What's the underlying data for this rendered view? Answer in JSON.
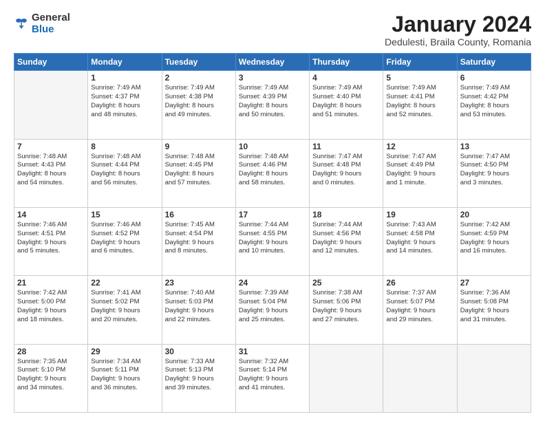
{
  "logo": {
    "general": "General",
    "blue": "Blue"
  },
  "title": "January 2024",
  "subtitle": "Dedulesti, Braila County, Romania",
  "days_header": [
    "Sunday",
    "Monday",
    "Tuesday",
    "Wednesday",
    "Thursday",
    "Friday",
    "Saturday"
  ],
  "weeks": [
    [
      {
        "day": "",
        "info": ""
      },
      {
        "day": "1",
        "info": "Sunrise: 7:49 AM\nSunset: 4:37 PM\nDaylight: 8 hours\nand 48 minutes."
      },
      {
        "day": "2",
        "info": "Sunrise: 7:49 AM\nSunset: 4:38 PM\nDaylight: 8 hours\nand 49 minutes."
      },
      {
        "day": "3",
        "info": "Sunrise: 7:49 AM\nSunset: 4:39 PM\nDaylight: 8 hours\nand 50 minutes."
      },
      {
        "day": "4",
        "info": "Sunrise: 7:49 AM\nSunset: 4:40 PM\nDaylight: 8 hours\nand 51 minutes."
      },
      {
        "day": "5",
        "info": "Sunrise: 7:49 AM\nSunset: 4:41 PM\nDaylight: 8 hours\nand 52 minutes."
      },
      {
        "day": "6",
        "info": "Sunrise: 7:49 AM\nSunset: 4:42 PM\nDaylight: 8 hours\nand 53 minutes."
      }
    ],
    [
      {
        "day": "7",
        "info": "Sunrise: 7:48 AM\nSunset: 4:43 PM\nDaylight: 8 hours\nand 54 minutes."
      },
      {
        "day": "8",
        "info": "Sunrise: 7:48 AM\nSunset: 4:44 PM\nDaylight: 8 hours\nand 56 minutes."
      },
      {
        "day": "9",
        "info": "Sunrise: 7:48 AM\nSunset: 4:45 PM\nDaylight: 8 hours\nand 57 minutes."
      },
      {
        "day": "10",
        "info": "Sunrise: 7:48 AM\nSunset: 4:46 PM\nDaylight: 8 hours\nand 58 minutes."
      },
      {
        "day": "11",
        "info": "Sunrise: 7:47 AM\nSunset: 4:48 PM\nDaylight: 9 hours\nand 0 minutes."
      },
      {
        "day": "12",
        "info": "Sunrise: 7:47 AM\nSunset: 4:49 PM\nDaylight: 9 hours\nand 1 minute."
      },
      {
        "day": "13",
        "info": "Sunrise: 7:47 AM\nSunset: 4:50 PM\nDaylight: 9 hours\nand 3 minutes."
      }
    ],
    [
      {
        "day": "14",
        "info": "Sunrise: 7:46 AM\nSunset: 4:51 PM\nDaylight: 9 hours\nand 5 minutes."
      },
      {
        "day": "15",
        "info": "Sunrise: 7:46 AM\nSunset: 4:52 PM\nDaylight: 9 hours\nand 6 minutes."
      },
      {
        "day": "16",
        "info": "Sunrise: 7:45 AM\nSunset: 4:54 PM\nDaylight: 9 hours\nand 8 minutes."
      },
      {
        "day": "17",
        "info": "Sunrise: 7:44 AM\nSunset: 4:55 PM\nDaylight: 9 hours\nand 10 minutes."
      },
      {
        "day": "18",
        "info": "Sunrise: 7:44 AM\nSunset: 4:56 PM\nDaylight: 9 hours\nand 12 minutes."
      },
      {
        "day": "19",
        "info": "Sunrise: 7:43 AM\nSunset: 4:58 PM\nDaylight: 9 hours\nand 14 minutes."
      },
      {
        "day": "20",
        "info": "Sunrise: 7:42 AM\nSunset: 4:59 PM\nDaylight: 9 hours\nand 16 minutes."
      }
    ],
    [
      {
        "day": "21",
        "info": "Sunrise: 7:42 AM\nSunset: 5:00 PM\nDaylight: 9 hours\nand 18 minutes."
      },
      {
        "day": "22",
        "info": "Sunrise: 7:41 AM\nSunset: 5:02 PM\nDaylight: 9 hours\nand 20 minutes."
      },
      {
        "day": "23",
        "info": "Sunrise: 7:40 AM\nSunset: 5:03 PM\nDaylight: 9 hours\nand 22 minutes."
      },
      {
        "day": "24",
        "info": "Sunrise: 7:39 AM\nSunset: 5:04 PM\nDaylight: 9 hours\nand 25 minutes."
      },
      {
        "day": "25",
        "info": "Sunrise: 7:38 AM\nSunset: 5:06 PM\nDaylight: 9 hours\nand 27 minutes."
      },
      {
        "day": "26",
        "info": "Sunrise: 7:37 AM\nSunset: 5:07 PM\nDaylight: 9 hours\nand 29 minutes."
      },
      {
        "day": "27",
        "info": "Sunrise: 7:36 AM\nSunset: 5:08 PM\nDaylight: 9 hours\nand 31 minutes."
      }
    ],
    [
      {
        "day": "28",
        "info": "Sunrise: 7:35 AM\nSunset: 5:10 PM\nDaylight: 9 hours\nand 34 minutes."
      },
      {
        "day": "29",
        "info": "Sunrise: 7:34 AM\nSunset: 5:11 PM\nDaylight: 9 hours\nand 36 minutes."
      },
      {
        "day": "30",
        "info": "Sunrise: 7:33 AM\nSunset: 5:13 PM\nDaylight: 9 hours\nand 39 minutes."
      },
      {
        "day": "31",
        "info": "Sunrise: 7:32 AM\nSunset: 5:14 PM\nDaylight: 9 hours\nand 41 minutes."
      },
      {
        "day": "",
        "info": ""
      },
      {
        "day": "",
        "info": ""
      },
      {
        "day": "",
        "info": ""
      }
    ]
  ]
}
